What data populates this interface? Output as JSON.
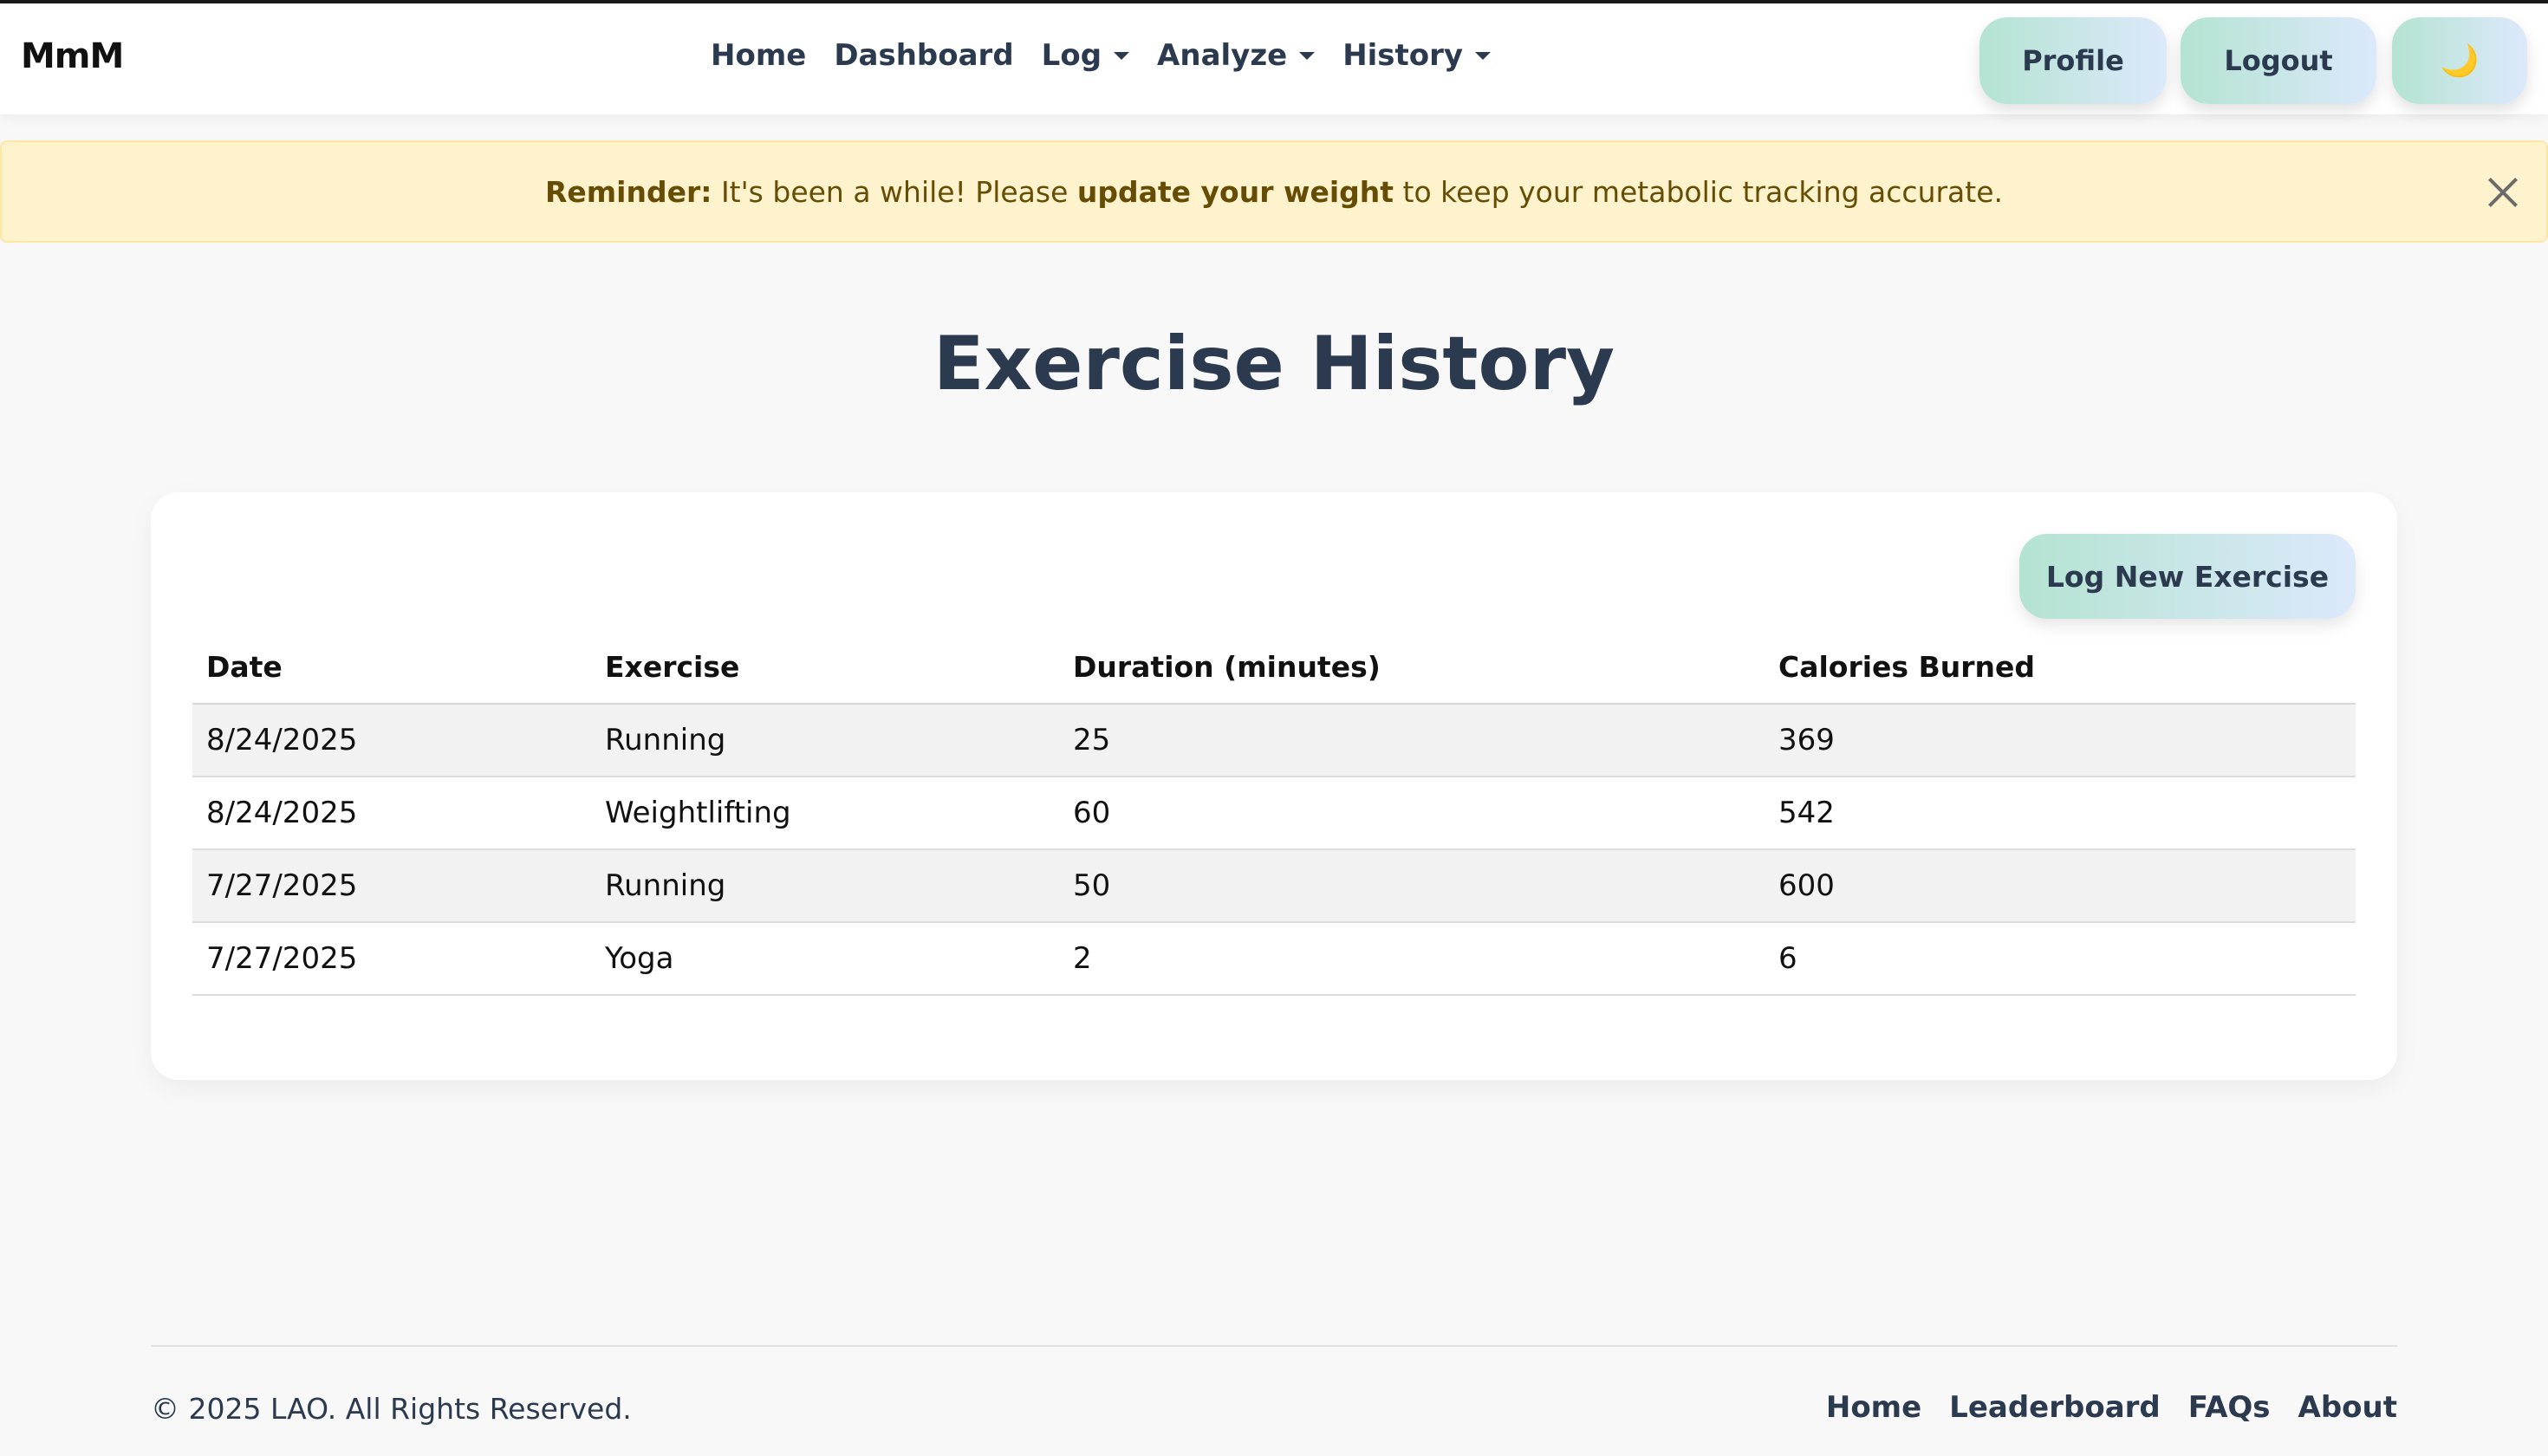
{
  "navbar": {
    "brand": "MmM",
    "links": [
      {
        "label": "Home"
      },
      {
        "label": "Dashboard"
      },
      {
        "label": "Log"
      },
      {
        "label": "Analyze"
      },
      {
        "label": "History"
      }
    ],
    "profile_label": "Profile",
    "logout_label": "Logout",
    "theme_icon": "🌙"
  },
  "alert": {
    "strong_label": "Reminder:",
    "text_before": " It's been a while! Please ",
    "link_text": "update your weight",
    "text_after": " to keep your metabolic tracking accurate."
  },
  "page": {
    "title": "Exercise History",
    "log_button_label": "Log New Exercise"
  },
  "table": {
    "headers": [
      "Date",
      "Exercise",
      "Duration (minutes)",
      "Calories Burned"
    ],
    "rows": [
      [
        "8/24/2025",
        "Running",
        "25",
        "369"
      ],
      [
        "8/24/2025",
        "Weightlifting",
        "60",
        "542"
      ],
      [
        "7/27/2025",
        "Running",
        "50",
        "600"
      ],
      [
        "7/27/2025",
        "Yoga",
        "2",
        "6"
      ]
    ]
  },
  "footer": {
    "copyright": "© 2025 LAO. All Rights Reserved.",
    "links": [
      "Home",
      "Leaderboard",
      "FAQs",
      "About"
    ]
  },
  "colors": {
    "accent_gradient_start": "#b4e3d2",
    "accent_gradient_end": "#dce9fb",
    "text_primary": "#2c3a4f",
    "alert_bg": "#fff3cd",
    "alert_text": "#664d03"
  }
}
